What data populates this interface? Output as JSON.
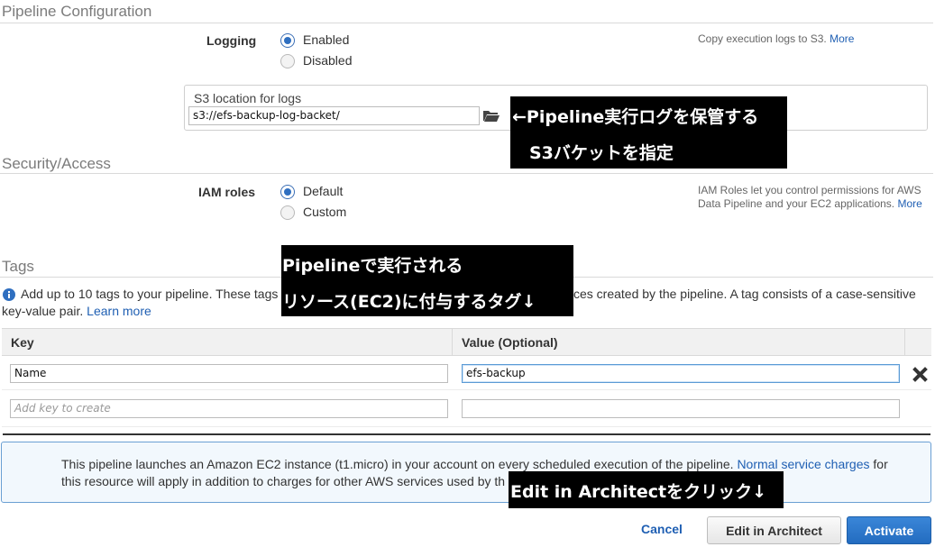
{
  "pipeline_config": {
    "title": "Pipeline Configuration",
    "logging_label": "Logging",
    "logging_options": [
      "Enabled",
      "Disabled"
    ],
    "logging_selected": "Enabled",
    "help_text": "Copy execution logs to S3.",
    "help_link": "More",
    "s3_label": "S3 location for logs",
    "s3_value": "s3://efs-backup-log-backet/",
    "folder_icon": "folder-open-icon"
  },
  "security": {
    "title": "Security/Access",
    "iam_label": "IAM roles",
    "iam_options": [
      "Default",
      "Custom"
    ],
    "iam_selected": "Default",
    "help_line1": "IAM Roles let you control permissions for AWS",
    "help_line2": "Data Pipeline and your EC2 applications.",
    "help_link": "More"
  },
  "tags": {
    "title": "Tags",
    "info_icon": "info-icon",
    "info_text_a": "Add up to 10 tags to your pipeline. These tags",
    "info_text_b": "ces created by the pipeline. A tag consists of a case-sensitive",
    "info_text_line2": "key-value pair.",
    "learn_more": "Learn more",
    "col_key": "Key",
    "col_value": "Value (Optional)",
    "rows": [
      {
        "key": "Name",
        "value": "efs-backup"
      }
    ],
    "new_key_placeholder": "Add key to create",
    "remove_icon": "close-icon"
  },
  "notice": {
    "line1_text": "This pipeline launches an Amazon EC2 instance (t1.micro) in your account on every scheduled execution of the pipeline.",
    "line1_link": "Normal service charges",
    "line1_tail": "for",
    "line2_text": "this resource will apply in addition to charges for other AWS services used by th"
  },
  "footer": {
    "cancel": "Cancel",
    "edit_in_architect": "Edit in Architect",
    "activate": "Activate"
  },
  "callouts": {
    "s3_line1": "←Pipeline実行ログを保管する",
    "s3_line2": "S3バケットを指定",
    "tags_line1": "Pipelineで実行される",
    "tags_line2": "リソース(EC2)に付与するタグ↓",
    "architect": "Edit in Architectをクリック↓"
  },
  "colors": {
    "accent": "#1f5fb3",
    "activate_bg": "#2a74c9",
    "notice_bg": "#f2f8fd",
    "notice_border": "#6a9fd3"
  }
}
